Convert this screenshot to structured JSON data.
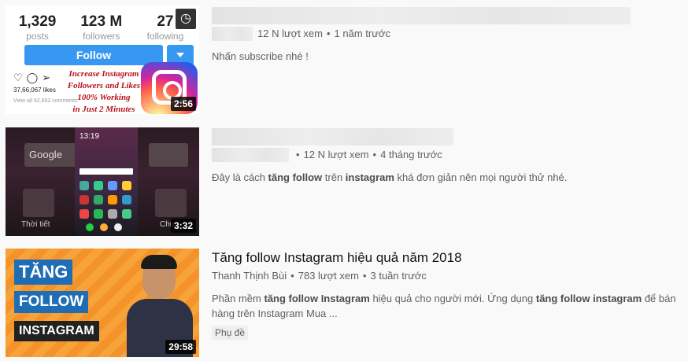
{
  "results": [
    {
      "duration": "2:56",
      "channel": "",
      "views": "12 N lượt xem",
      "age": "1 năm trước",
      "description": "Nhấn subscribe nhé !",
      "thumb": {
        "posts": "1,329",
        "posts_label": "posts",
        "followers": "123 M",
        "followers_label": "followers",
        "following": "27",
        "following_label": "following",
        "follow_button": "Follow",
        "likes": "37,66,067 likes",
        "comments": "View all 62,663 comments",
        "promo_lines": [
          "Increase Instagram",
          "Followers and Likes",
          "100% Working",
          "in Just 2 Minutes"
        ]
      }
    },
    {
      "duration": "3:32",
      "views": "12 N lượt xem",
      "age": "4 tháng trước",
      "description_parts": [
        "Đây là cách ",
        "tăng follow",
        " trên ",
        "instagram",
        " khá đơn giản nên mọi người thử nhé."
      ],
      "thumb": {
        "time": "13:19",
        "search": "Google",
        "left_label": "Thời tiết",
        "right_label": "Chu"
      }
    },
    {
      "duration": "29:58",
      "title": "Tăng follow Instagram hiệu quả năm 2018",
      "channel": "Thanh Thịnh Bùi",
      "views": "783 lượt xem",
      "age": "3 tuần trước",
      "description_parts": [
        "Phần mềm ",
        "tăng follow Instagram",
        " hiệu quả cho người mới. Ứng dụng ",
        "tăng follow instagram",
        " để bán hàng trên Instagram Mua ..."
      ],
      "badge": "Phụ đề",
      "thumb": {
        "word1": "TĂNG",
        "word2": "FOLLOW",
        "word3": "INSTAGRAM"
      }
    }
  ],
  "colors": {
    "background": "#f9f9f9",
    "follow_blue": "#3897f0",
    "meta_gray": "#606060"
  }
}
